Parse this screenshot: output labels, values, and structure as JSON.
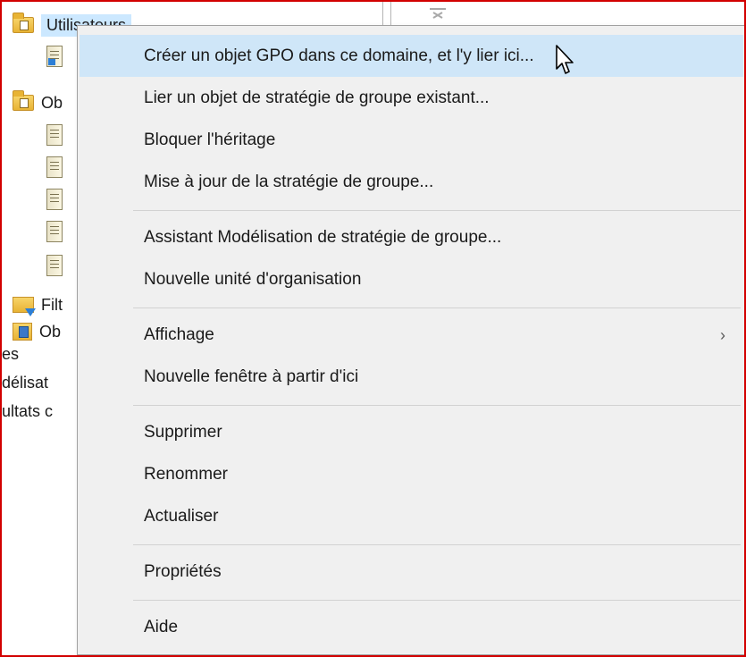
{
  "tree": {
    "items": [
      {
        "label": "Utilisateurs",
        "icon": "ou-folder-icon"
      },
      {
        "label": "",
        "icon": "gpo-link-icon"
      },
      {
        "label": "Ob",
        "icon": "gpo-folder-icon"
      },
      {
        "label": "",
        "icon": "gpo-scroll-icon"
      },
      {
        "label": "",
        "icon": "gpo-scroll-icon"
      },
      {
        "label": "",
        "icon": "gpo-scroll-icon"
      },
      {
        "label": "",
        "icon": "gpo-scroll-icon"
      },
      {
        "label": "",
        "icon": "gpo-scroll-icon"
      },
      {
        "label": "Filt",
        "icon": "wmi-filter-icon"
      },
      {
        "label": "Ob",
        "icon": "starter-gpo-icon"
      },
      {
        "label": "es"
      },
      {
        "label": "délisat"
      },
      {
        "label": "ultats c"
      }
    ]
  },
  "context_menu": {
    "items": [
      {
        "label": "Créer un objet GPO dans ce domaine, et l'y lier ici...",
        "highlighted": true
      },
      {
        "label": "Lier un objet de stratégie de groupe existant..."
      },
      {
        "label": "Bloquer l'héritage"
      },
      {
        "label": "Mise à jour de la stratégie de groupe..."
      },
      {
        "label": "Assistant Modélisation de stratégie de groupe..."
      },
      {
        "label": "Nouvelle unité d'organisation"
      },
      {
        "label": "Affichage",
        "submenu_arrow": "›"
      },
      {
        "label": "Nouvelle fenêtre à partir d'ici"
      },
      {
        "label": "Supprimer"
      },
      {
        "label": "Renommer"
      },
      {
        "label": "Actualiser"
      },
      {
        "label": "Propriétés"
      },
      {
        "label": "Aide"
      }
    ]
  },
  "colors": {
    "highlight": "#cfe6f8",
    "menu_bg": "#f0f0f0",
    "frame": "#d20000"
  }
}
